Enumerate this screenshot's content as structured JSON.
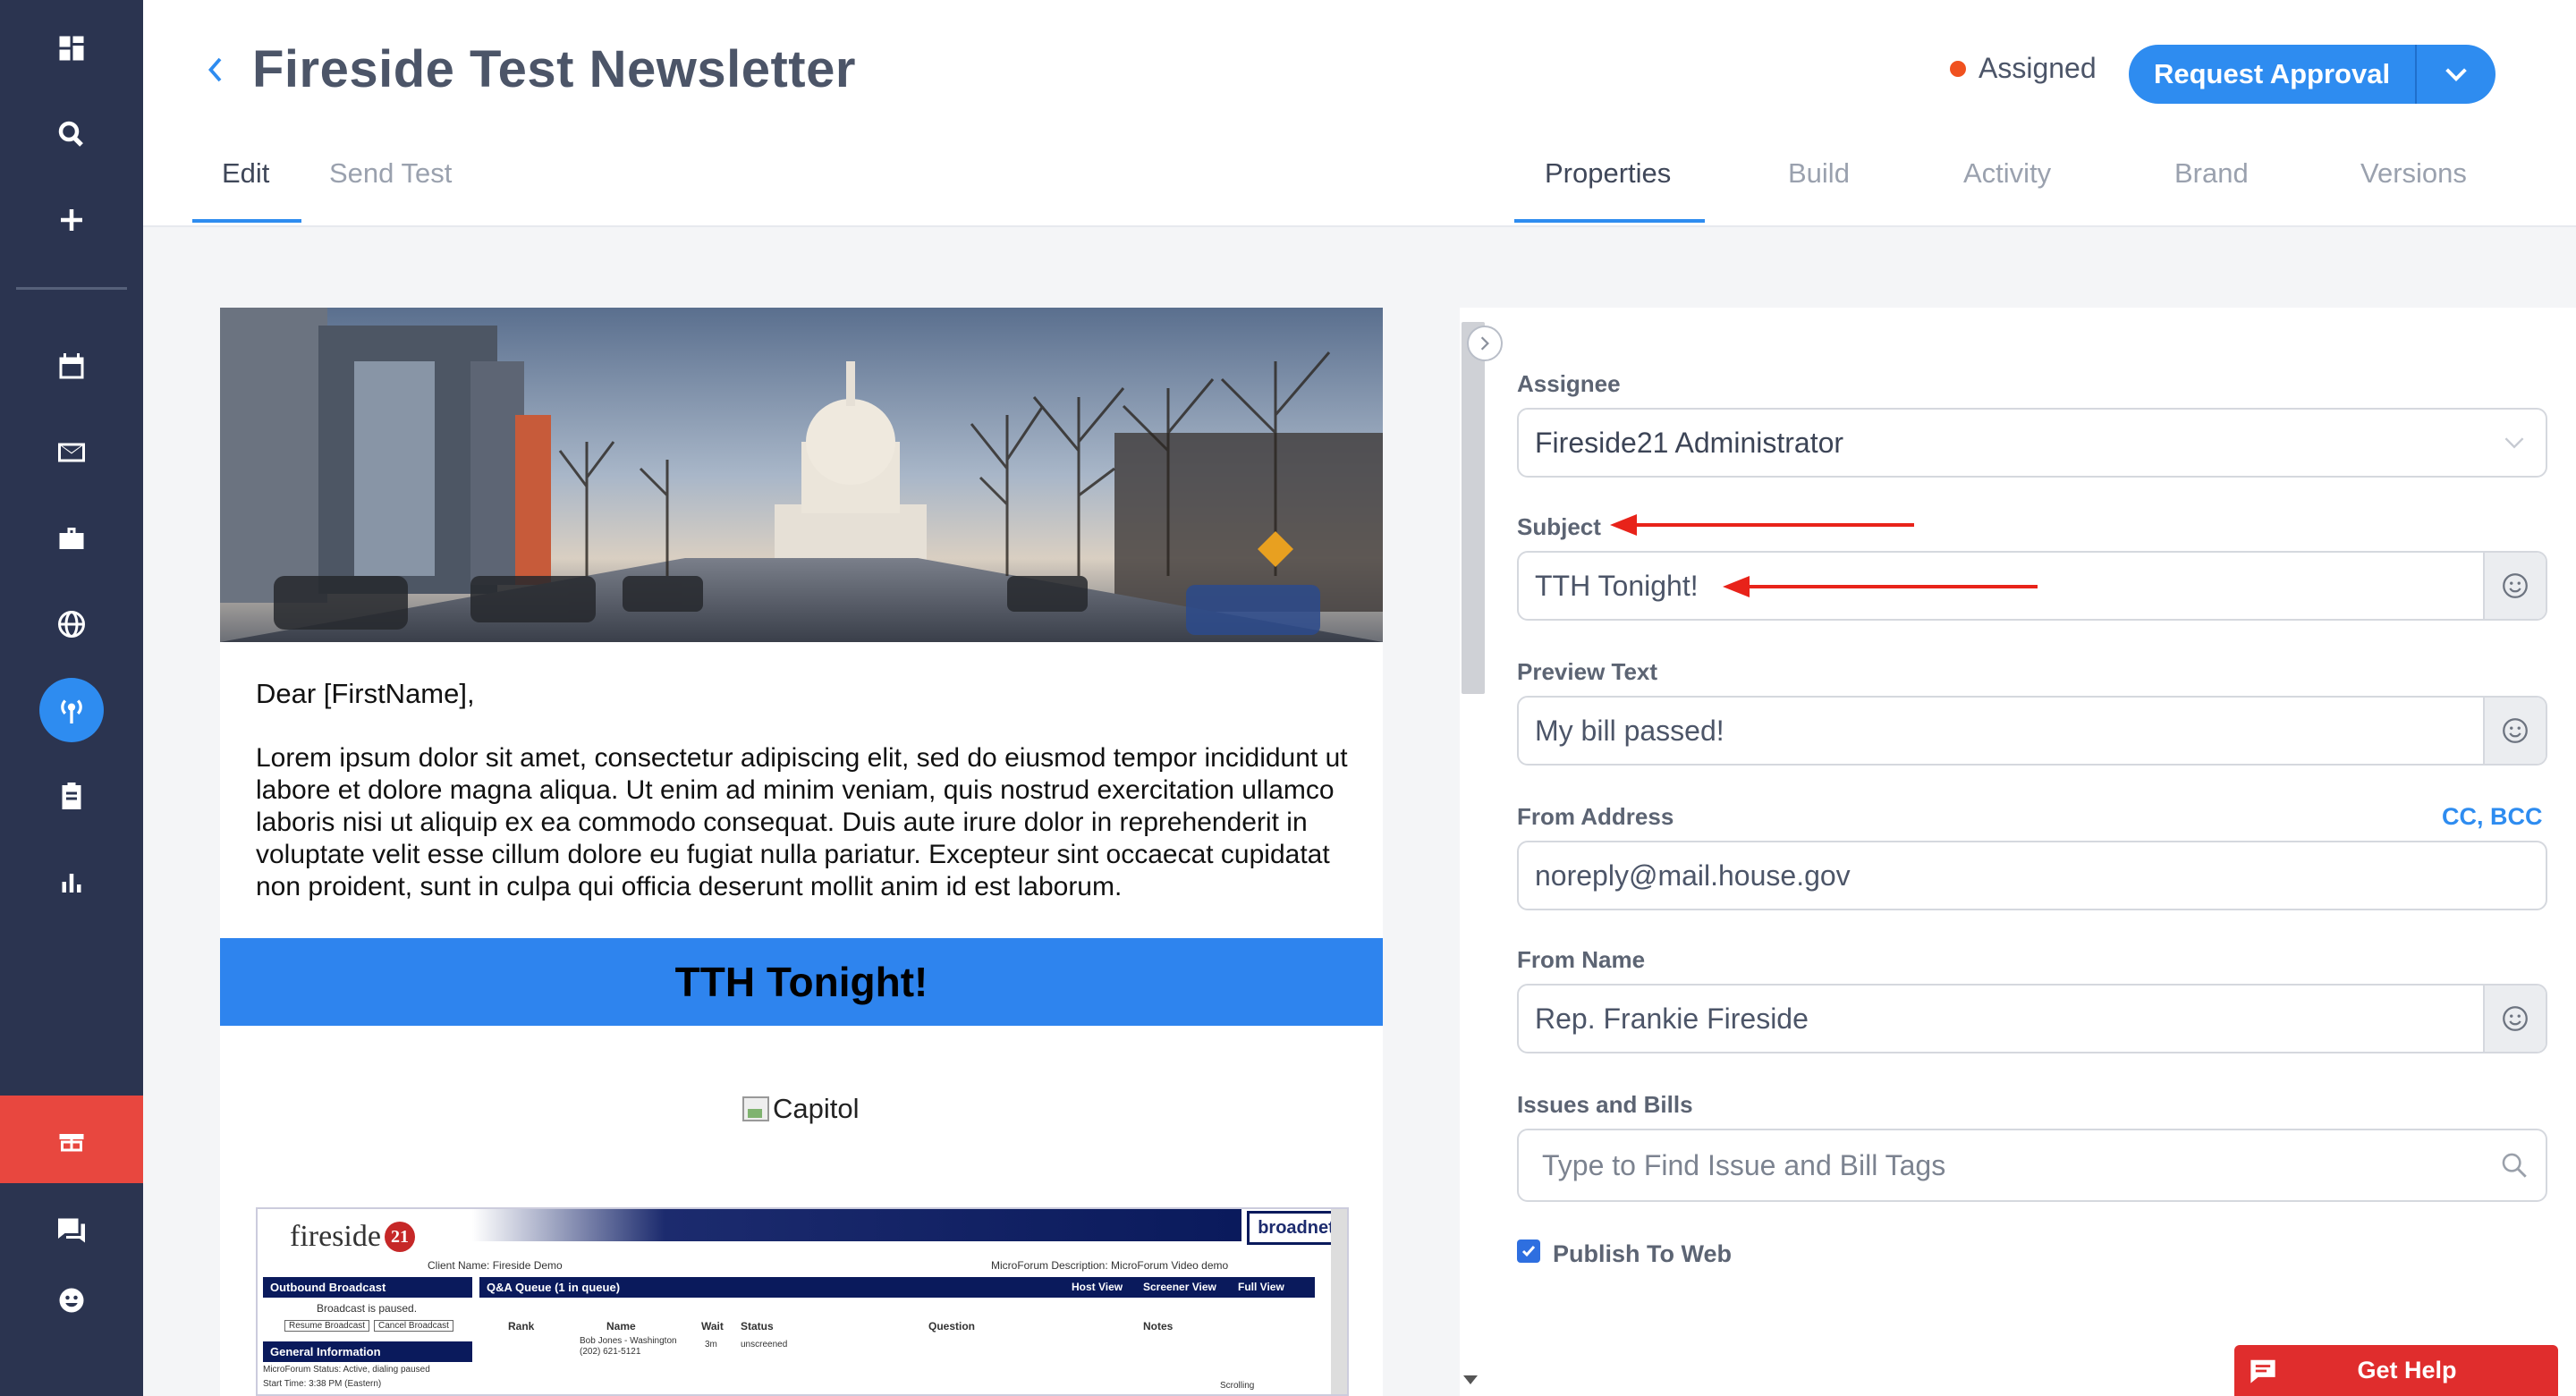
{
  "header": {
    "title": "Fireside Test Newsletter",
    "status": "Assigned",
    "request_button": "Request Approval"
  },
  "left_tabs": [
    {
      "label": "Edit",
      "active": true
    },
    {
      "label": "Send Test",
      "active": false
    }
  ],
  "right_tabs": [
    {
      "label": "Properties",
      "active": true
    },
    {
      "label": "Build",
      "active": false
    },
    {
      "label": "Activity",
      "active": false
    },
    {
      "label": "Brand",
      "active": false
    },
    {
      "label": "Versions",
      "active": false
    }
  ],
  "sidebar": {
    "icons": [
      "dashboard-icon",
      "search-icon",
      "plus-icon",
      "calendar-icon",
      "mail-icon",
      "briefcase-icon",
      "globe-icon",
      "broadcast-icon",
      "clipboard-icon",
      "bar-chart-icon",
      "gift-icon",
      "chat-icon",
      "smiley-icon"
    ],
    "active": "broadcast-icon"
  },
  "email": {
    "greeting": "Dear [FirstName],",
    "body": "Lorem ipsum dolor sit amet, consectetur adipiscing elit, sed do eiusmod tempor incididunt ut labore et dolore magna aliqua. Ut enim ad minim veniam, quis nostrud exercitation ullamco laboris nisi ut aliquip ex ea commodo consequat. Duis aute irure dolor in reprehenderit in voluptate velit esse cillum dolore eu fugiat nulla pariatur. Excepteur sint occaecat cupidatat non proident, sunt in culpa qui officia deserunt mollit anim id est laborum.",
    "banner": "TTH Tonight!",
    "broken_image_alt": "Capitol",
    "screenshot": {
      "logo": "fireside",
      "logo_badge": "21",
      "partner_logo": "broadnet",
      "client_name": "Client Name:   Fireside Demo",
      "event_desc": "MicroForum Description:   MicroForum Video demo",
      "outbound_panel": "Outbound Broadcast",
      "outbound_status": "Broadcast is paused.",
      "resume_btn": "Resume Broadcast",
      "cancel_btn": "Cancel Broadcast",
      "general_panel": "General Information",
      "queue_panel": "Q&A Queue (1 in queue)",
      "host_view": "Host View",
      "screener_view": "Screener View",
      "full_view": "Full View",
      "columns": [
        "Rank",
        "Name",
        "Wait",
        "Status",
        "Question",
        "Notes"
      ],
      "row_name": "Bob Jones - Washington",
      "row_phone": "(202) 621-5121",
      "row_wait": "3m",
      "row_status": "unscreened",
      "info_status": "MicroForum Status:   Active, dialing paused",
      "info_start": "Start Time:   3:38 PM (Eastern)",
      "scrolling": "Scrolling"
    }
  },
  "properties": {
    "assignee_label": "Assignee",
    "assignee_value": "Fireside21 Administrator",
    "subject_label": "Subject",
    "subject_value": "TTH Tonight!",
    "preview_label": "Preview Text",
    "preview_value": "My bill passed!",
    "from_address_label": "From Address",
    "cc_bcc": "CC, BCC",
    "from_address_value": "noreply@mail.house.gov",
    "from_name_label": "From Name",
    "from_name_value": "Rep. Frankie Fireside",
    "issues_label": "Issues and Bills",
    "issues_placeholder": "Type to Find Issue and Bill Tags",
    "publish_label": "Publish To Web",
    "publish_checked": true
  },
  "help": {
    "label": "Get Help"
  },
  "colors": {
    "sidebar_bg": "#2b3450",
    "accent": "#2e8cf0",
    "status_dot": "#f0511f",
    "help_red": "#e02d2d",
    "annotation_arrow": "#e8231a"
  }
}
